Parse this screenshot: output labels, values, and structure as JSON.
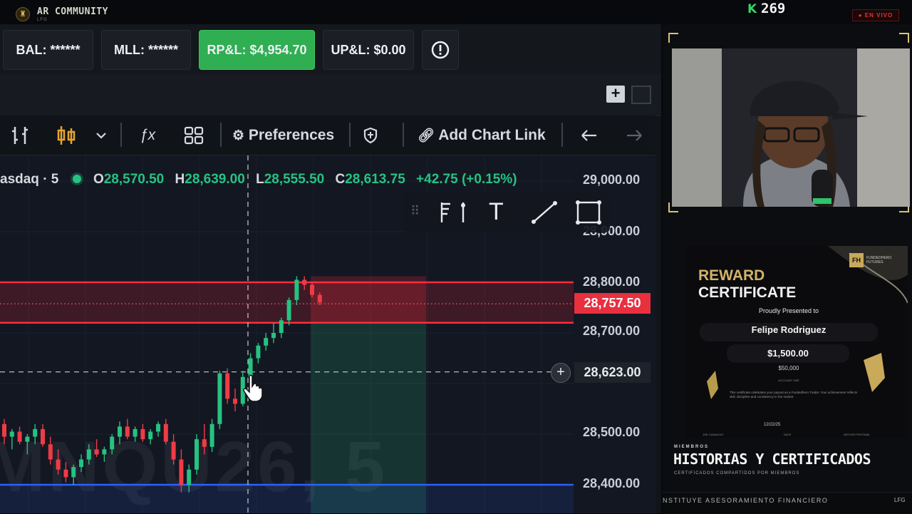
{
  "stream": {
    "channel": "AR COMMUNITY",
    "channel_sub": "LFG",
    "viewers": "269",
    "live_label": "● EN VIVO",
    "ticker": "NSTITUYE ASESORAMIENTO FINANCIERO",
    "ticker_tag": "LFG"
  },
  "account": {
    "bal": "BAL: ******",
    "mll": "MLL: ******",
    "rpl": "RP&L: $4,954.70",
    "upl": "UP&L: $0.00"
  },
  "toolbar": {
    "preferences": "Preferences",
    "add_chart_link": "Add Chart Link"
  },
  "chart": {
    "symbol_label": "asdaq · 5",
    "ohlc": {
      "o_label": "O",
      "o": "28,570.50",
      "h_label": "H",
      "h": "28,639.00",
      "l_label": "L",
      "l": "28,555.50",
      "c_label": "C",
      "c": "28,613.75",
      "change": "+42.75 (+0.15%)"
    },
    "price_ticks": [
      "29,000.00",
      "28,900.00",
      "28,800.00",
      "28,700.00",
      "28,623.00",
      "28,500.00",
      "28,400.00"
    ],
    "current_price": "28,757.50",
    "watermark": "MNQU26, 5",
    "colors": {
      "up": "#26c281",
      "down": "#ef3b46",
      "zone_red": "#ff2c3d",
      "line_blue": "#2962ff"
    }
  },
  "chart_data": {
    "type": "candlestick",
    "title": "",
    "ylim": [
      28380,
      29020
    ],
    "levels": [
      28800,
      28757.5,
      28720,
      28623,
      28400
    ],
    "candles": [
      {
        "o": 28520,
        "h": 28530,
        "l": 28480,
        "c": 28495
      },
      {
        "o": 28495,
        "h": 28510,
        "l": 28470,
        "c": 28505
      },
      {
        "o": 28505,
        "h": 28515,
        "l": 28480,
        "c": 28485
      },
      {
        "o": 28485,
        "h": 28500,
        "l": 28460,
        "c": 28495
      },
      {
        "o": 28495,
        "h": 28520,
        "l": 28480,
        "c": 28510
      },
      {
        "o": 28510,
        "h": 28520,
        "l": 28475,
        "c": 28480
      },
      {
        "o": 28480,
        "h": 28495,
        "l": 28440,
        "c": 28450
      },
      {
        "o": 28450,
        "h": 28470,
        "l": 28420,
        "c": 28430
      },
      {
        "o": 28430,
        "h": 28445,
        "l": 28405,
        "c": 28415
      },
      {
        "o": 28415,
        "h": 28440,
        "l": 28400,
        "c": 28435
      },
      {
        "o": 28435,
        "h": 28460,
        "l": 28425,
        "c": 28450
      },
      {
        "o": 28450,
        "h": 28480,
        "l": 28440,
        "c": 28470
      },
      {
        "o": 28470,
        "h": 28490,
        "l": 28455,
        "c": 28460
      },
      {
        "o": 28460,
        "h": 28475,
        "l": 28445,
        "c": 28470
      },
      {
        "o": 28470,
        "h": 28500,
        "l": 28460,
        "c": 28495
      },
      {
        "o": 28495,
        "h": 28525,
        "l": 28480,
        "c": 28515
      },
      {
        "o": 28515,
        "h": 28530,
        "l": 28490,
        "c": 28495
      },
      {
        "o": 28495,
        "h": 28515,
        "l": 28485,
        "c": 28510
      },
      {
        "o": 28510,
        "h": 28520,
        "l": 28485,
        "c": 28490
      },
      {
        "o": 28490,
        "h": 28510,
        "l": 28480,
        "c": 28505
      },
      {
        "o": 28505,
        "h": 28525,
        "l": 28495,
        "c": 28520
      },
      {
        "o": 28520,
        "h": 28530,
        "l": 28480,
        "c": 28485
      },
      {
        "o": 28485,
        "h": 28500,
        "l": 28440,
        "c": 28450
      },
      {
        "o": 28450,
        "h": 28470,
        "l": 28385,
        "c": 28400
      },
      {
        "o": 28400,
        "h": 28440,
        "l": 28385,
        "c": 28430
      },
      {
        "o": 28430,
        "h": 28500,
        "l": 28420,
        "c": 28490
      },
      {
        "o": 28490,
        "h": 28520,
        "l": 28460,
        "c": 28475
      },
      {
        "o": 28475,
        "h": 28530,
        "l": 28465,
        "c": 28520
      },
      {
        "o": 28520,
        "h": 28625,
        "l": 28510,
        "c": 28620
      },
      {
        "o": 28620,
        "h": 28630,
        "l": 28560,
        "c": 28570
      },
      {
        "o": 28570,
        "h": 28590,
        "l": 28545,
        "c": 28560
      },
      {
        "o": 28560,
        "h": 28625,
        "l": 28555,
        "c": 28613
      },
      {
        "o": 28613,
        "h": 28660,
        "l": 28600,
        "c": 28650
      },
      {
        "o": 28650,
        "h": 28680,
        "l": 28640,
        "c": 28675
      },
      {
        "o": 28675,
        "h": 28700,
        "l": 28665,
        "c": 28690
      },
      {
        "o": 28690,
        "h": 28720,
        "l": 28680,
        "c": 28700
      },
      {
        "o": 28700,
        "h": 28730,
        "l": 28690,
        "c": 28725
      },
      {
        "o": 28725,
        "h": 28770,
        "l": 28715,
        "c": 28765
      },
      {
        "o": 28765,
        "h": 28812,
        "l": 28755,
        "c": 28805
      },
      {
        "o": 28805,
        "h": 28812,
        "l": 28785,
        "c": 28795
      },
      {
        "o": 28795,
        "h": 28800,
        "l": 28770,
        "c": 28775
      },
      {
        "o": 28775,
        "h": 28780,
        "l": 28755,
        "c": 28760
      }
    ]
  },
  "certificate": {
    "title_1": "REWARD",
    "title_2": "CERTIFICATE",
    "presented": "Proudly Presented to",
    "name": "Felipe Rodriguez",
    "amount": "$1,500.00",
    "account_size": "$50,000",
    "account_label": "ACCOUNT SIZE",
    "body": "This certificate celebrates your payout as a Fundedhero Trader. Your achievement reflects skill, discipline and consistency in the market.",
    "date": "12/22/25",
    "date_label": "DATE",
    "signer_1": "JOE CAMACHO",
    "signer_2": "ARTURO PESTANA",
    "brand": "FUNDEDHERO FUTURES"
  },
  "segment": {
    "kicker": "MIEMBROS",
    "title": "HISTORIAS Y CERTIFICADOS",
    "subtitle": "CERTIFICADOS COMPARTIDOS POR MIEMBROS"
  }
}
